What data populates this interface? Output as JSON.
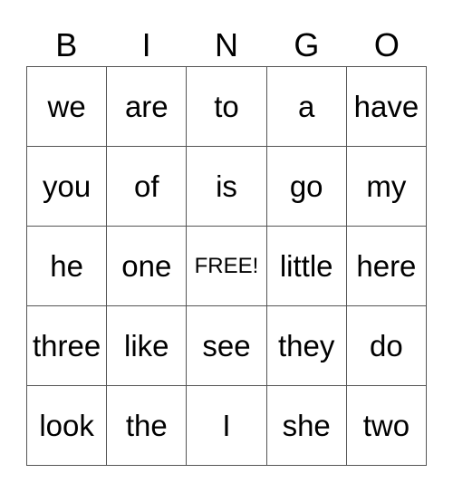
{
  "header": [
    "B",
    "I",
    "N",
    "G",
    "O"
  ],
  "rows": [
    [
      "we",
      "are",
      "to",
      "a",
      "have"
    ],
    [
      "you",
      "of",
      "is",
      "go",
      "my"
    ],
    [
      "he",
      "one",
      "FREE!",
      "little",
      "here"
    ],
    [
      "three",
      "like",
      "see",
      "they",
      "do"
    ],
    [
      "look",
      "the",
      "I",
      "she",
      "two"
    ]
  ],
  "free_cell": [
    2,
    2
  ]
}
